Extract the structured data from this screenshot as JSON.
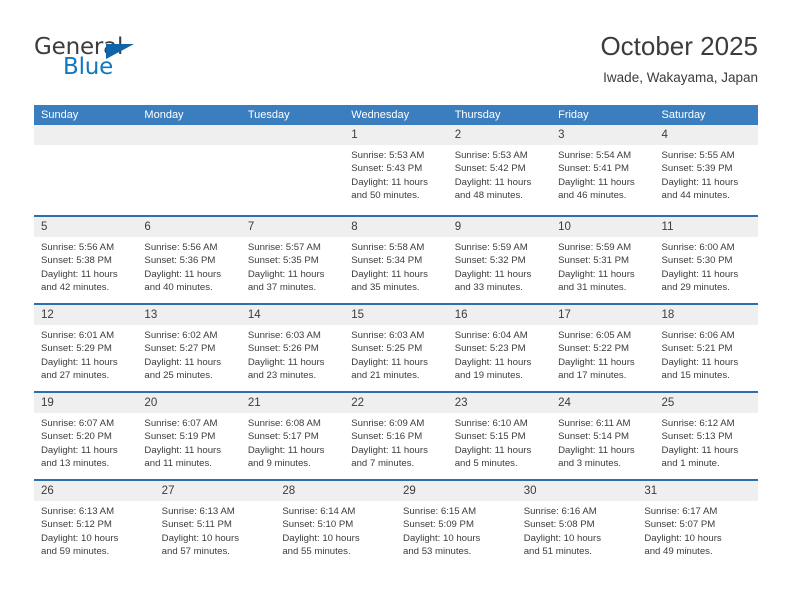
{
  "brand": {
    "name_top": "General",
    "name_bottom": "Blue",
    "triangle_icon": "triangle-icon",
    "accent_blue": "#1278be",
    "triangle_blue": "#1064a8"
  },
  "header": {
    "month_title": "October 2025",
    "location": "Iwade, Wakayama, Japan"
  },
  "theme": {
    "header_blue": "#3b7ebf",
    "row_separator_blue": "#2f6ead",
    "daynum_band_gray": "#efefef",
    "text_gray": "#3c3c3c"
  },
  "calendar": {
    "weekday_headers": [
      "Sunday",
      "Monday",
      "Tuesday",
      "Wednesday",
      "Thursday",
      "Friday",
      "Saturday"
    ],
    "weeks": [
      [
        {
          "day": "",
          "lines": []
        },
        {
          "day": "",
          "lines": []
        },
        {
          "day": "",
          "lines": []
        },
        {
          "day": "1",
          "lines": [
            "Sunrise: 5:53 AM",
            "Sunset: 5:43 PM",
            "Daylight: 11 hours",
            "and 50 minutes."
          ]
        },
        {
          "day": "2",
          "lines": [
            "Sunrise: 5:53 AM",
            "Sunset: 5:42 PM",
            "Daylight: 11 hours",
            "and 48 minutes."
          ]
        },
        {
          "day": "3",
          "lines": [
            "Sunrise: 5:54 AM",
            "Sunset: 5:41 PM",
            "Daylight: 11 hours",
            "and 46 minutes."
          ]
        },
        {
          "day": "4",
          "lines": [
            "Sunrise: 5:55 AM",
            "Sunset: 5:39 PM",
            "Daylight: 11 hours",
            "and 44 minutes."
          ]
        }
      ],
      [
        {
          "day": "5",
          "lines": [
            "Sunrise: 5:56 AM",
            "Sunset: 5:38 PM",
            "Daylight: 11 hours",
            "and 42 minutes."
          ]
        },
        {
          "day": "6",
          "lines": [
            "Sunrise: 5:56 AM",
            "Sunset: 5:36 PM",
            "Daylight: 11 hours",
            "and 40 minutes."
          ]
        },
        {
          "day": "7",
          "lines": [
            "Sunrise: 5:57 AM",
            "Sunset: 5:35 PM",
            "Daylight: 11 hours",
            "and 37 minutes."
          ]
        },
        {
          "day": "8",
          "lines": [
            "Sunrise: 5:58 AM",
            "Sunset: 5:34 PM",
            "Daylight: 11 hours",
            "and 35 minutes."
          ]
        },
        {
          "day": "9",
          "lines": [
            "Sunrise: 5:59 AM",
            "Sunset: 5:32 PM",
            "Daylight: 11 hours",
            "and 33 minutes."
          ]
        },
        {
          "day": "10",
          "lines": [
            "Sunrise: 5:59 AM",
            "Sunset: 5:31 PM",
            "Daylight: 11 hours",
            "and 31 minutes."
          ]
        },
        {
          "day": "11",
          "lines": [
            "Sunrise: 6:00 AM",
            "Sunset: 5:30 PM",
            "Daylight: 11 hours",
            "and 29 minutes."
          ]
        }
      ],
      [
        {
          "day": "12",
          "lines": [
            "Sunrise: 6:01 AM",
            "Sunset: 5:29 PM",
            "Daylight: 11 hours",
            "and 27 minutes."
          ]
        },
        {
          "day": "13",
          "lines": [
            "Sunrise: 6:02 AM",
            "Sunset: 5:27 PM",
            "Daylight: 11 hours",
            "and 25 minutes."
          ]
        },
        {
          "day": "14",
          "lines": [
            "Sunrise: 6:03 AM",
            "Sunset: 5:26 PM",
            "Daylight: 11 hours",
            "and 23 minutes."
          ]
        },
        {
          "day": "15",
          "lines": [
            "Sunrise: 6:03 AM",
            "Sunset: 5:25 PM",
            "Daylight: 11 hours",
            "and 21 minutes."
          ]
        },
        {
          "day": "16",
          "lines": [
            "Sunrise: 6:04 AM",
            "Sunset: 5:23 PM",
            "Daylight: 11 hours",
            "and 19 minutes."
          ]
        },
        {
          "day": "17",
          "lines": [
            "Sunrise: 6:05 AM",
            "Sunset: 5:22 PM",
            "Daylight: 11 hours",
            "and 17 minutes."
          ]
        },
        {
          "day": "18",
          "lines": [
            "Sunrise: 6:06 AM",
            "Sunset: 5:21 PM",
            "Daylight: 11 hours",
            "and 15 minutes."
          ]
        }
      ],
      [
        {
          "day": "19",
          "lines": [
            "Sunrise: 6:07 AM",
            "Sunset: 5:20 PM",
            "Daylight: 11 hours",
            "and 13 minutes."
          ]
        },
        {
          "day": "20",
          "lines": [
            "Sunrise: 6:07 AM",
            "Sunset: 5:19 PM",
            "Daylight: 11 hours",
            "and 11 minutes."
          ]
        },
        {
          "day": "21",
          "lines": [
            "Sunrise: 6:08 AM",
            "Sunset: 5:17 PM",
            "Daylight: 11 hours",
            "and 9 minutes."
          ]
        },
        {
          "day": "22",
          "lines": [
            "Sunrise: 6:09 AM",
            "Sunset: 5:16 PM",
            "Daylight: 11 hours",
            "and 7 minutes."
          ]
        },
        {
          "day": "23",
          "lines": [
            "Sunrise: 6:10 AM",
            "Sunset: 5:15 PM",
            "Daylight: 11 hours",
            "and 5 minutes."
          ]
        },
        {
          "day": "24",
          "lines": [
            "Sunrise: 6:11 AM",
            "Sunset: 5:14 PM",
            "Daylight: 11 hours",
            "and 3 minutes."
          ]
        },
        {
          "day": "25",
          "lines": [
            "Sunrise: 6:12 AM",
            "Sunset: 5:13 PM",
            "Daylight: 11 hours",
            "and 1 minute."
          ]
        }
      ],
      [
        {
          "day": "26",
          "lines": [
            "Sunrise: 6:13 AM",
            "Sunset: 5:12 PM",
            "Daylight: 10 hours",
            "and 59 minutes."
          ]
        },
        {
          "day": "27",
          "lines": [
            "Sunrise: 6:13 AM",
            "Sunset: 5:11 PM",
            "Daylight: 10 hours",
            "and 57 minutes."
          ]
        },
        {
          "day": "28",
          "lines": [
            "Sunrise: 6:14 AM",
            "Sunset: 5:10 PM",
            "Daylight: 10 hours",
            "and 55 minutes."
          ]
        },
        {
          "day": "29",
          "lines": [
            "Sunrise: 6:15 AM",
            "Sunset: 5:09 PM",
            "Daylight: 10 hours",
            "and 53 minutes."
          ]
        },
        {
          "day": "30",
          "lines": [
            "Sunrise: 6:16 AM",
            "Sunset: 5:08 PM",
            "Daylight: 10 hours",
            "and 51 minutes."
          ]
        },
        {
          "day": "31",
          "lines": [
            "Sunrise: 6:17 AM",
            "Sunset: 5:07 PM",
            "Daylight: 10 hours",
            "and 49 minutes."
          ]
        }
      ]
    ]
  }
}
